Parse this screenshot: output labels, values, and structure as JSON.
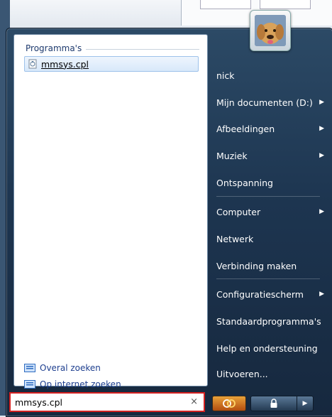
{
  "search_results": {
    "group_header": "Programma's",
    "items": [
      {
        "label": "mmsys.cpl",
        "icon": "control-panel-file-icon"
      }
    ]
  },
  "search_links": [
    {
      "label": "Overal zoeken",
      "icon": "search-everywhere-icon"
    },
    {
      "label": "Op internet zoeken",
      "icon": "search-internet-icon"
    }
  ],
  "search": {
    "value": "mmsys.cpl",
    "clear_label": "×"
  },
  "right_pane": {
    "items": [
      {
        "label": "nick",
        "has_arrow": false
      },
      {
        "label": "Mijn documenten (D:)",
        "has_arrow": true
      },
      {
        "label": "Afbeeldingen",
        "has_arrow": true
      },
      {
        "label": "Muziek",
        "has_arrow": true
      },
      {
        "label": "Ontspanning",
        "has_arrow": false
      },
      {
        "label": "Computer",
        "has_arrow": true
      },
      {
        "label": "Netwerk",
        "has_arrow": false
      },
      {
        "label": "Verbinding maken",
        "has_arrow": false
      },
      {
        "label": "Configuratiescherm",
        "has_arrow": true
      },
      {
        "label": "Standaardprogramma's",
        "has_arrow": false
      },
      {
        "label": "Help en ondersteuning",
        "has_arrow": false
      },
      {
        "label": "Uitvoeren...",
        "has_arrow": false
      }
    ],
    "arrow_glyph": "▶"
  },
  "power": {
    "power_icon": "power-icon",
    "lock_icon": "lock-icon",
    "menu_arrow": "▶"
  },
  "colors": {
    "search_highlight": "#d42020",
    "menu_bg": "#1d3550",
    "link": "#1e3f8f"
  }
}
